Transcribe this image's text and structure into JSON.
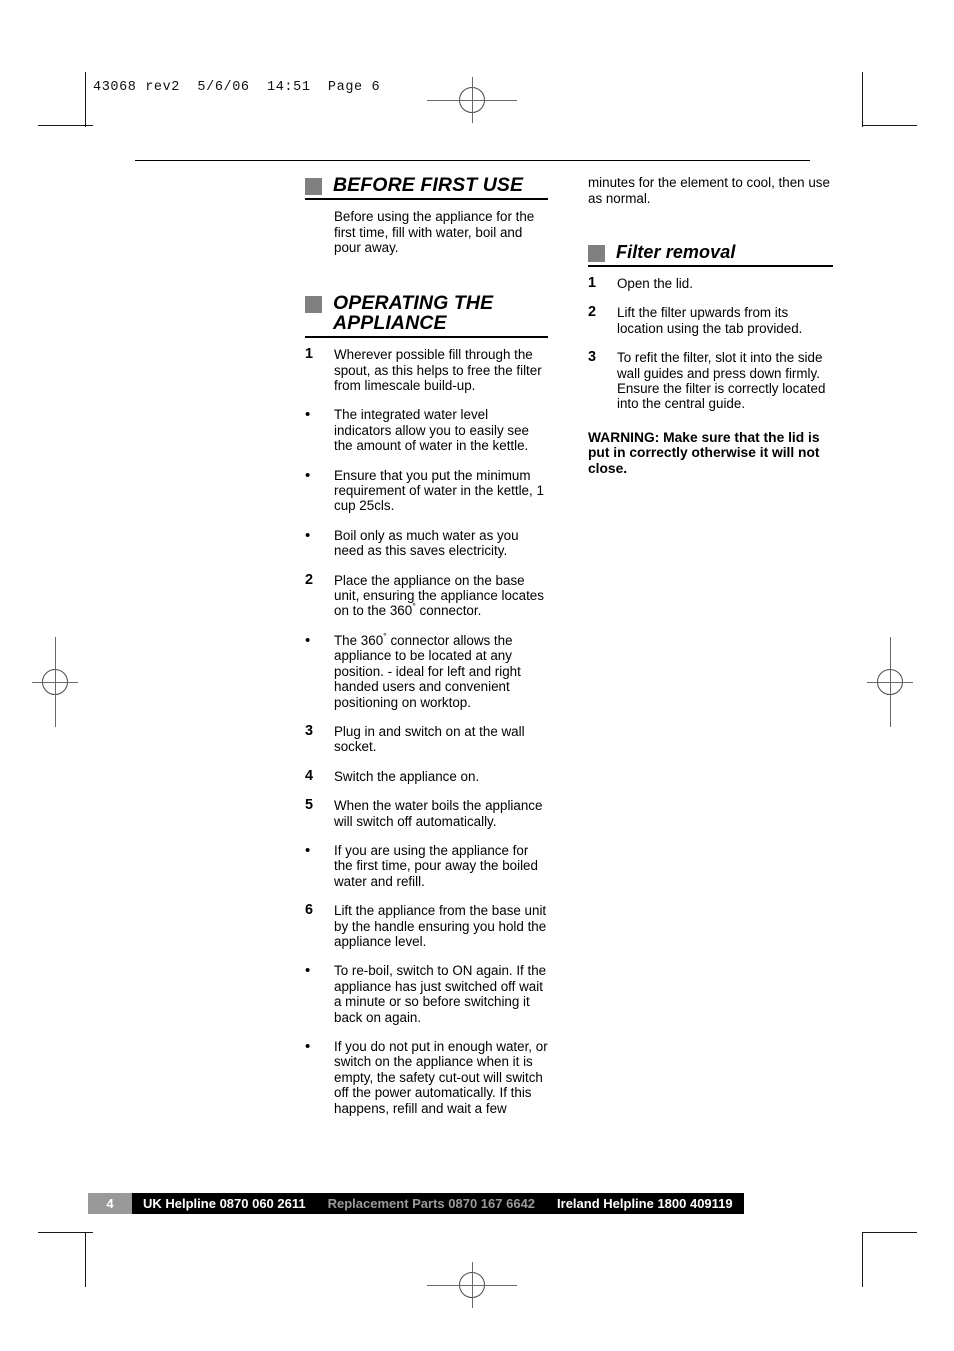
{
  "prepress": {
    "header_line": "43068 rev2  5/6/06  14:51  Page 6"
  },
  "left_column": {
    "section1": {
      "heading": "BEFORE FIRST USE",
      "paragraph": "Before using the appliance for the first time, fill with water, boil and pour away."
    },
    "section2": {
      "heading": "OPERATING THE APPLIANCE",
      "items": [
        {
          "marker": "1",
          "text": "Wherever possible fill through the spout, as this helps to free the filter from limescale build-up."
        },
        {
          "marker": "•",
          "text": "The integrated water level indicators allow you to easily see the amount of water in the kettle."
        },
        {
          "marker": "•",
          "text": "Ensure that you put the minimum requirement of water in the kettle, 1 cup 25cls."
        },
        {
          "marker": "•",
          "text": "Boil only as much water as you need as this saves electricity."
        },
        {
          "marker": "2",
          "text_pre": "Place the appliance on the base unit, ensuring the appliance locates on to the 360",
          "degree": "°",
          "text_post": " connector."
        },
        {
          "marker": "•",
          "text_pre": "The 360",
          "degree": "°",
          "text_post": " connector allows the appliance to be located at any position. - ideal for left and right handed users and convenient positioning on worktop."
        },
        {
          "marker": "3",
          "text": "Plug in and switch on at the wall socket."
        },
        {
          "marker": "4",
          "text": "Switch the appliance on."
        },
        {
          "marker": "5",
          "text": "When the water boils the appliance will switch off automatically."
        },
        {
          "marker": "•",
          "text": "If you are using the appliance for the first time, pour away the boiled water and refill."
        },
        {
          "marker": "6",
          "text": "Lift the appliance from the base unit by the handle ensuring you hold the appliance level."
        },
        {
          "marker": "•",
          "text": "To re-boil, switch to ON again. If the appliance has just switched off wait a minute or so before switching it back on again."
        },
        {
          "marker": "•",
          "text": "If you do not put in enough water, or switch on the appliance when it is empty, the safety cut-out will switch off the power automatically. If this happens, refill and wait a few"
        }
      ]
    }
  },
  "right_column": {
    "continuation": "minutes for the element to cool, then use as normal.",
    "section": {
      "heading": "Filter removal",
      "items": [
        {
          "marker": "1",
          "text": "Open the lid."
        },
        {
          "marker": "2",
          "text": "Lift the filter upwards from its location using the tab provided."
        },
        {
          "marker": "3",
          "text": "To refit the filter, slot it into the side wall guides and press down firmly. Ensure the filter is correctly located into the central guide."
        }
      ],
      "warning": "WARNING: Make sure that the lid is put in correctly otherwise it will not close."
    }
  },
  "footer": {
    "page_number": "4",
    "uk_helpline": "UK Helpline 0870 060 2611",
    "replacement_parts": "Replacement Parts 0870 167 6642",
    "ireland_helpline": "Ireland Helpline 1800 409119"
  }
}
